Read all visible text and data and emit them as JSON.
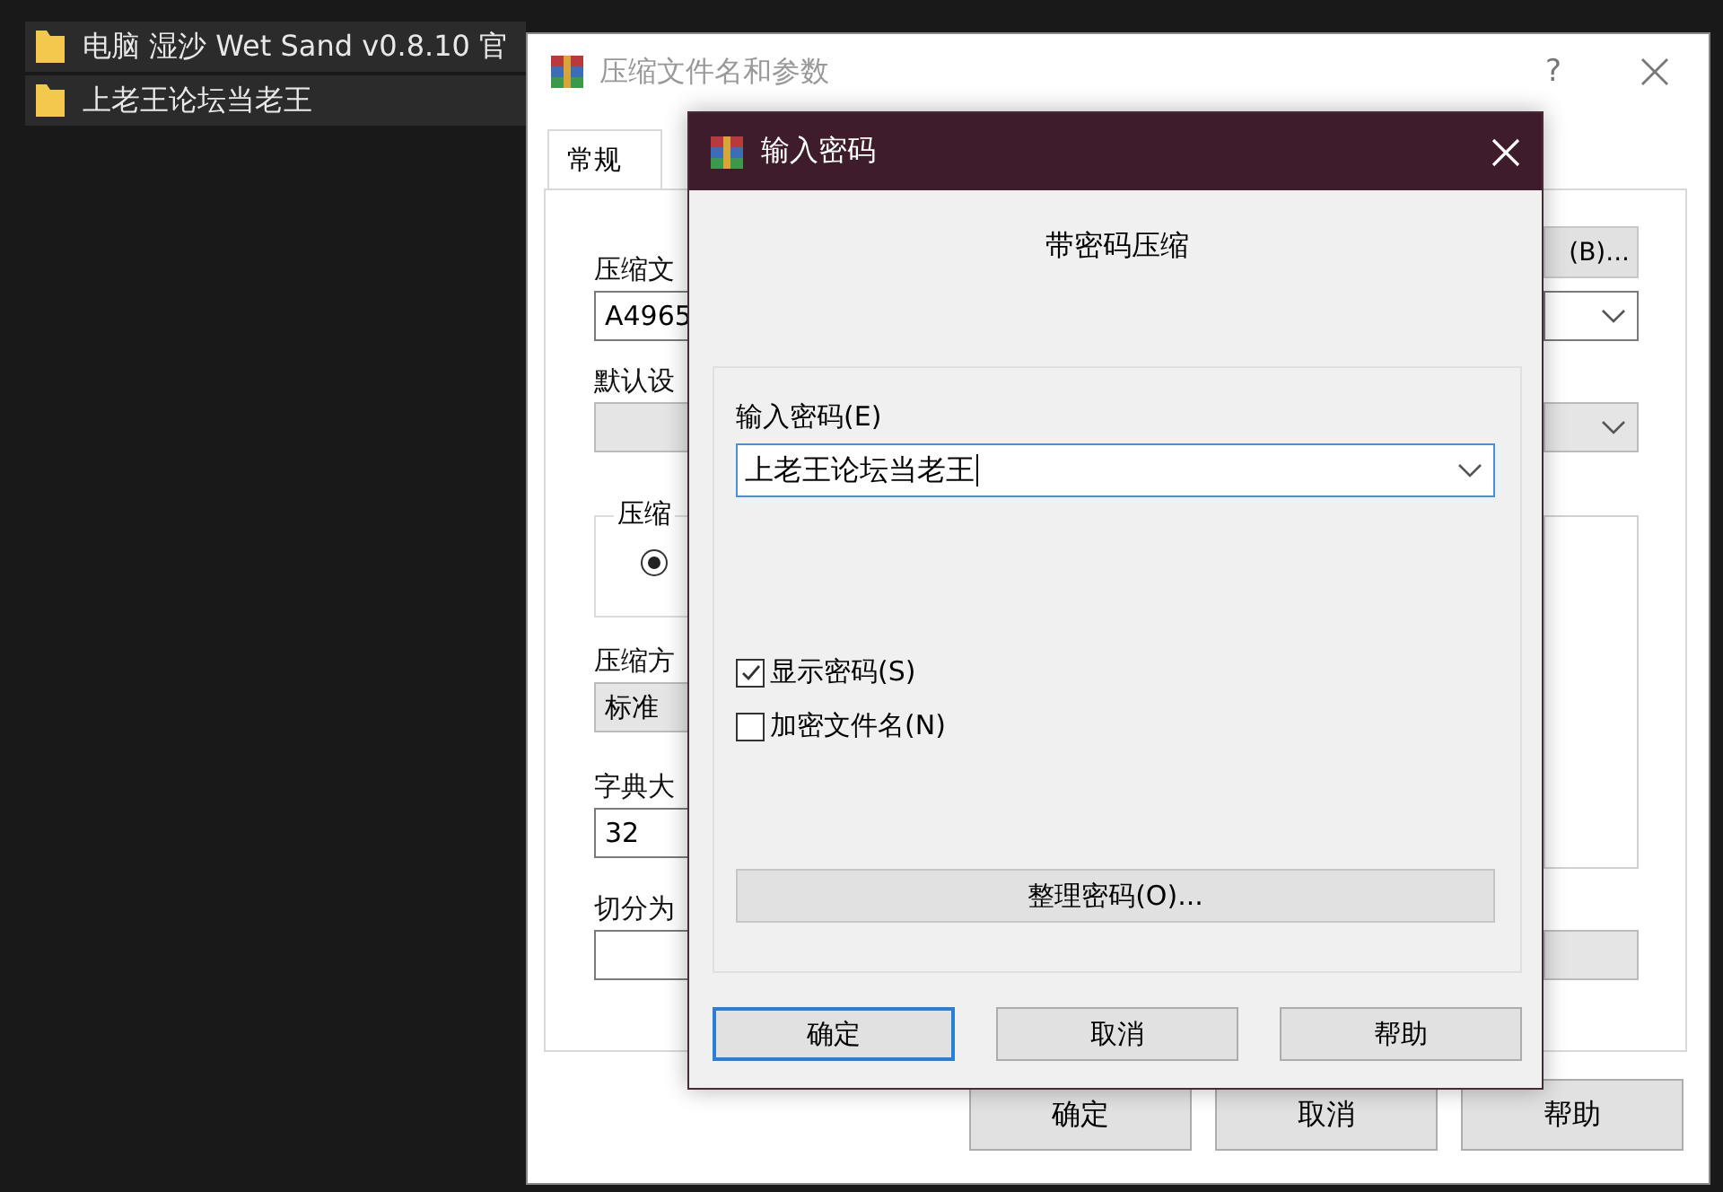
{
  "explorer": {
    "items": [
      {
        "name": "电脑 湿沙 Wet Sand v0.8.10 官"
      },
      {
        "name": "上老王论坛当老王"
      }
    ]
  },
  "back_dialog": {
    "title": "压缩文件名和参数",
    "help": "?",
    "tabs": [
      {
        "label": "常规",
        "selected": true
      }
    ],
    "archive_name_label": "压缩文",
    "archive_name": "A4965",
    "browse_button": "(B)...",
    "profile_label": "默认设",
    "group_label": "压缩",
    "radio": {
      "selected": true
    },
    "method_label": "压缩方",
    "method": "标准",
    "dictionary_label": "字典大",
    "dictionary": "32",
    "split_label": "切分为",
    "buttons": [
      "确定",
      "取消",
      "帮助"
    ]
  },
  "password_dialog": {
    "title": "输入密码",
    "heading": "带密码压缩",
    "password_label": "输入密码(E)",
    "password": "上老王论坛当老王",
    "options": [
      {
        "label": "显示密码(S)",
        "checked": true
      },
      {
        "label": "加密文件名(N)",
        "checked": false
      }
    ],
    "organize_button": "整理密码(O)...",
    "buttons": [
      {
        "label": "确定",
        "default": true
      },
      {
        "label": "取消",
        "default": false
      },
      {
        "label": "帮助",
        "default": false
      }
    ]
  }
}
